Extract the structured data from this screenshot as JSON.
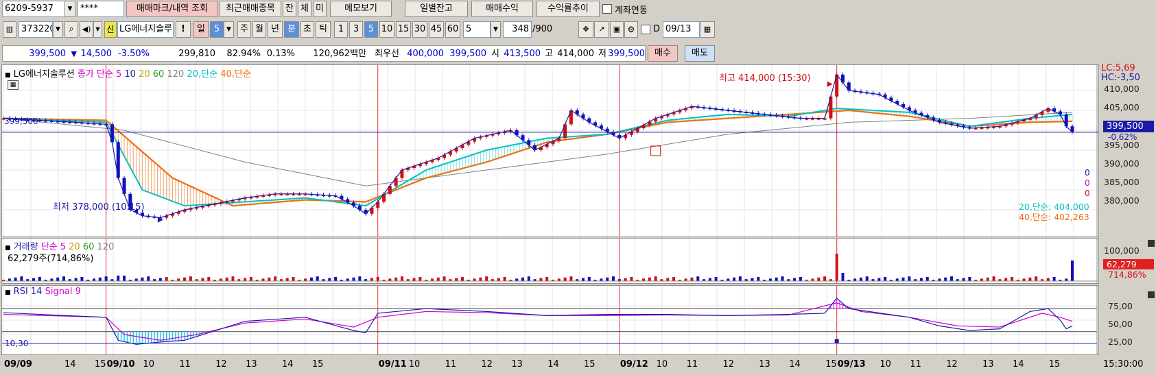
{
  "toolbar1": {
    "account": "6209-5937",
    "password": "****",
    "btn_trade_mark": "매매마크/내역 조회",
    "btn_recent": "최근매매종목",
    "btn_jan": "잔",
    "btn_che": "체",
    "btn_mi": "미",
    "btn_memo": "메모보기",
    "btn_daily_balance": "일별잔고",
    "btn_trade_profit": "매매수익",
    "btn_return_trend": "수익률추이",
    "account_link_label": "계좌연동"
  },
  "toolbar2": {
    "code": "373220",
    "stock_name_badge": "신",
    "stock_name": "LG에너지솔루",
    "btn_excl": "!",
    "period_il": "일",
    "period_il_num": "5",
    "period_ju": "주",
    "period_wol": "월",
    "period_nyeon": "년",
    "period_bun": "분",
    "period_cho": "초",
    "period_tik": "틱",
    "minutes": [
      "1",
      "3",
      "5",
      "10",
      "15",
      "30",
      "45",
      "60"
    ],
    "minute_select": "5",
    "count": "348",
    "count_max": "/900",
    "date_label": "D",
    "date": "09/13"
  },
  "quote": {
    "price": "399,500",
    "arrow": "▼",
    "change": "14,500",
    "change_pct": "-3.50%",
    "volume": "299,810",
    "vol_ratio": "82.94%",
    "turnover": "0.13%",
    "amount": "120,962백만",
    "best_label": "최우선",
    "best_ask": "400,000",
    "best_bid": "399,500",
    "open_label": "시",
    "open": "413,500",
    "high_label": "고",
    "high": "414,000",
    "low_label": "저",
    "low": "399,500",
    "btn_buy": "매수",
    "btn_sell": "매도"
  },
  "price_panel": {
    "legend": [
      "LG에너지솔루션",
      "종가 단순 5",
      "10",
      "20",
      "60",
      "120",
      "20,단순",
      "40,단순"
    ],
    "high_note": "최고 414,000 (15:30)",
    "low_note": "최저 378,000 (10:15)",
    "lc": "LC:5,69",
    "hc": "HC:-3,50",
    "current_price": "399,500",
    "current_pct": "-0,62%",
    "left_price": "399,500",
    "y_ticks": [
      "410,000",
      "405,000",
      "395,000",
      "390,000",
      "385,000",
      "380,000"
    ],
    "zeros": [
      "0",
      "0",
      "0"
    ],
    "ma20_readout": "20,단순: 404,000",
    "ma40_readout": "40,단순: 402,263"
  },
  "volume_panel": {
    "legend": [
      "거래량",
      "단순 5",
      "20",
      "60",
      "120"
    ],
    "readout": "62,279주(714,86%)",
    "y_tick": "100,000",
    "current": "62,279",
    "current_pct": "714,86%"
  },
  "rsi_panel": {
    "legend": [
      "RSI 14",
      "Signal 9"
    ],
    "left_value": "10,30",
    "y_ticks": [
      "75,00",
      "50,00",
      "25,00"
    ]
  },
  "x_axis": {
    "labels": [
      "09/09",
      "14",
      "15",
      "09/10",
      "10",
      "11",
      "12",
      "13",
      "14",
      "15",
      "09/11",
      "10",
      "11",
      "12",
      "13",
      "14",
      "15",
      "09/12",
      "10",
      "11",
      "12",
      "13",
      "14",
      "15",
      "09/13",
      "10",
      "11",
      "12",
      "13",
      "14",
      "15"
    ],
    "time": "15:30:00"
  },
  "colors": {
    "price_line": "#1a1aa8",
    "candle_up": "#d01010",
    "candle_down": "#1010c0",
    "ma5": "#cc00cc",
    "ma10": "#1a1aa8",
    "ma20": "#00c0c0",
    "ma40": "#f07010",
    "ma60": "#20a020",
    "ma120": "#808080"
  },
  "chart_data": {
    "type": "line",
    "title": "LG에너지솔루션",
    "ylim": [
      375000,
      415000
    ],
    "day_labels": [
      "09/09",
      "09/10",
      "09/11",
      "09/12",
      "09/13"
    ],
    "close_path_points": [
      [
        0,
        403000
      ],
      [
        6,
        402500
      ],
      [
        12,
        402000
      ],
      [
        17,
        401500
      ],
      [
        18,
        397000
      ],
      [
        19,
        388000
      ],
      [
        21,
        380000
      ],
      [
        23,
        378500
      ],
      [
        26,
        378000
      ],
      [
        30,
        380000
      ],
      [
        35,
        381500
      ],
      [
        40,
        383000
      ],
      [
        45,
        384000
      ],
      [
        50,
        384000
      ],
      [
        55,
        383500
      ],
      [
        58,
        381000
      ],
      [
        60,
        379000
      ],
      [
        62,
        382000
      ],
      [
        66,
        390000
      ],
      [
        72,
        393000
      ],
      [
        78,
        398000
      ],
      [
        84,
        400000
      ],
      [
        88,
        395000
      ],
      [
        92,
        398000
      ],
      [
        94,
        405000
      ],
      [
        97,
        402000
      ],
      [
        102,
        398000
      ],
      [
        108,
        403000
      ],
      [
        114,
        406000
      ],
      [
        120,
        405000
      ],
      [
        126,
        404000
      ],
      [
        132,
        403000
      ],
      [
        136,
        403000
      ],
      [
        138,
        414000
      ],
      [
        140,
        410000
      ],
      [
        145,
        409000
      ],
      [
        150,
        405000
      ],
      [
        155,
        402000
      ],
      [
        160,
        400500
      ],
      [
        165,
        401000
      ],
      [
        170,
        403000
      ],
      [
        173,
        405500
      ],
      [
        175,
        404000
      ],
      [
        176,
        401000
      ],
      [
        177,
        399500
      ]
    ],
    "ma20_points": [
      [
        0,
        403000
      ],
      [
        17,
        402000
      ],
      [
        23,
        385000
      ],
      [
        30,
        381000
      ],
      [
        40,
        382000
      ],
      [
        50,
        383000
      ],
      [
        60,
        381000
      ],
      [
        70,
        390000
      ],
      [
        80,
        395000
      ],
      [
        90,
        398000
      ],
      [
        100,
        399000
      ],
      [
        110,
        402500
      ],
      [
        120,
        404000
      ],
      [
        130,
        403500
      ],
      [
        138,
        405500
      ],
      [
        150,
        404500
      ],
      [
        160,
        401000
      ],
      [
        170,
        403000
      ],
      [
        177,
        404000
      ]
    ],
    "ma40_points": [
      [
        0,
        403000
      ],
      [
        17,
        402500
      ],
      [
        28,
        388000
      ],
      [
        38,
        381000
      ],
      [
        50,
        382500
      ],
      [
        60,
        382000
      ],
      [
        70,
        388000
      ],
      [
        80,
        392000
      ],
      [
        90,
        397000
      ],
      [
        100,
        399000
      ],
      [
        110,
        402000
      ],
      [
        120,
        403000
      ],
      [
        130,
        404000
      ],
      [
        140,
        405000
      ],
      [
        150,
        403500
      ],
      [
        160,
        401000
      ],
      [
        170,
        402000
      ],
      [
        177,
        402263
      ]
    ],
    "ma120_points": [
      [
        0,
        403000
      ],
      [
        20,
        400000
      ],
      [
        40,
        392000
      ],
      [
        60,
        386000
      ],
      [
        80,
        390000
      ],
      [
        100,
        394000
      ],
      [
        120,
        399000
      ],
      [
        140,
        402000
      ],
      [
        160,
        403000
      ],
      [
        177,
        404500
      ]
    ],
    "rsi_points": [
      [
        0,
        63
      ],
      [
        10,
        58
      ],
      [
        17,
        55
      ],
      [
        19,
        15
      ],
      [
        22,
        8
      ],
      [
        26,
        12
      ],
      [
        30,
        15
      ],
      [
        40,
        48
      ],
      [
        50,
        55
      ],
      [
        58,
        32
      ],
      [
        60,
        28
      ],
      [
        62,
        62
      ],
      [
        70,
        70
      ],
      [
        80,
        65
      ],
      [
        90,
        58
      ],
      [
        100,
        60
      ],
      [
        110,
        60
      ],
      [
        120,
        58
      ],
      [
        130,
        60
      ],
      [
        136,
        62
      ],
      [
        138,
        88
      ],
      [
        140,
        70
      ],
      [
        150,
        55
      ],
      [
        155,
        40
      ],
      [
        160,
        32
      ],
      [
        165,
        35
      ],
      [
        170,
        65
      ],
      [
        173,
        70
      ],
      [
        175,
        50
      ],
      [
        176,
        35
      ],
      [
        177,
        40
      ]
    ],
    "signal_points": [
      [
        0,
        60
      ],
      [
        17,
        55
      ],
      [
        20,
        25
      ],
      [
        26,
        15
      ],
      [
        32,
        25
      ],
      [
        40,
        45
      ],
      [
        50,
        52
      ],
      [
        58,
        38
      ],
      [
        62,
        55
      ],
      [
        70,
        65
      ],
      [
        80,
        63
      ],
      [
        90,
        58
      ],
      [
        100,
        58
      ],
      [
        110,
        59
      ],
      [
        120,
        58
      ],
      [
        130,
        59
      ],
      [
        138,
        80
      ],
      [
        142,
        65
      ],
      [
        150,
        55
      ],
      [
        158,
        40
      ],
      [
        165,
        38
      ],
      [
        172,
        62
      ],
      [
        175,
        55
      ],
      [
        177,
        48
      ]
    ]
  }
}
